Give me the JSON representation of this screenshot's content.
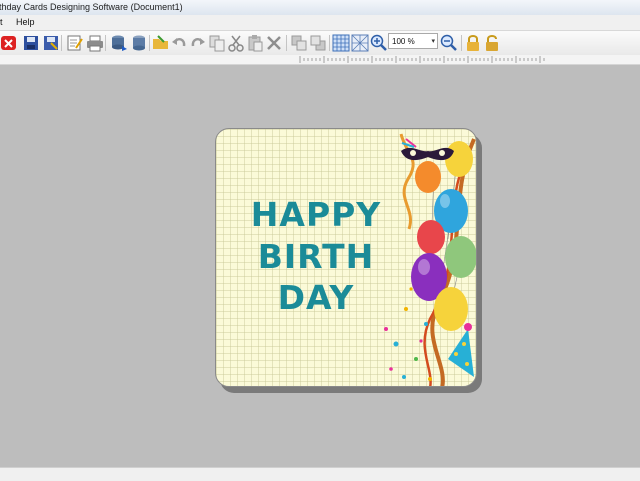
{
  "window": {
    "title": "thday Cards Designing Software  (Document1)"
  },
  "menu": {
    "items": [
      "t",
      "Help"
    ]
  },
  "toolbar": {
    "zoom_value": "100 %",
    "zoom_dropdown": "▾"
  },
  "card": {
    "lines": [
      "HAPPY",
      "BIRTH",
      "DAY"
    ]
  },
  "colors": {
    "greeting_text": "#1b8b98",
    "canvas_background": "#bdbdbd",
    "card_background": "#fbfad8"
  }
}
